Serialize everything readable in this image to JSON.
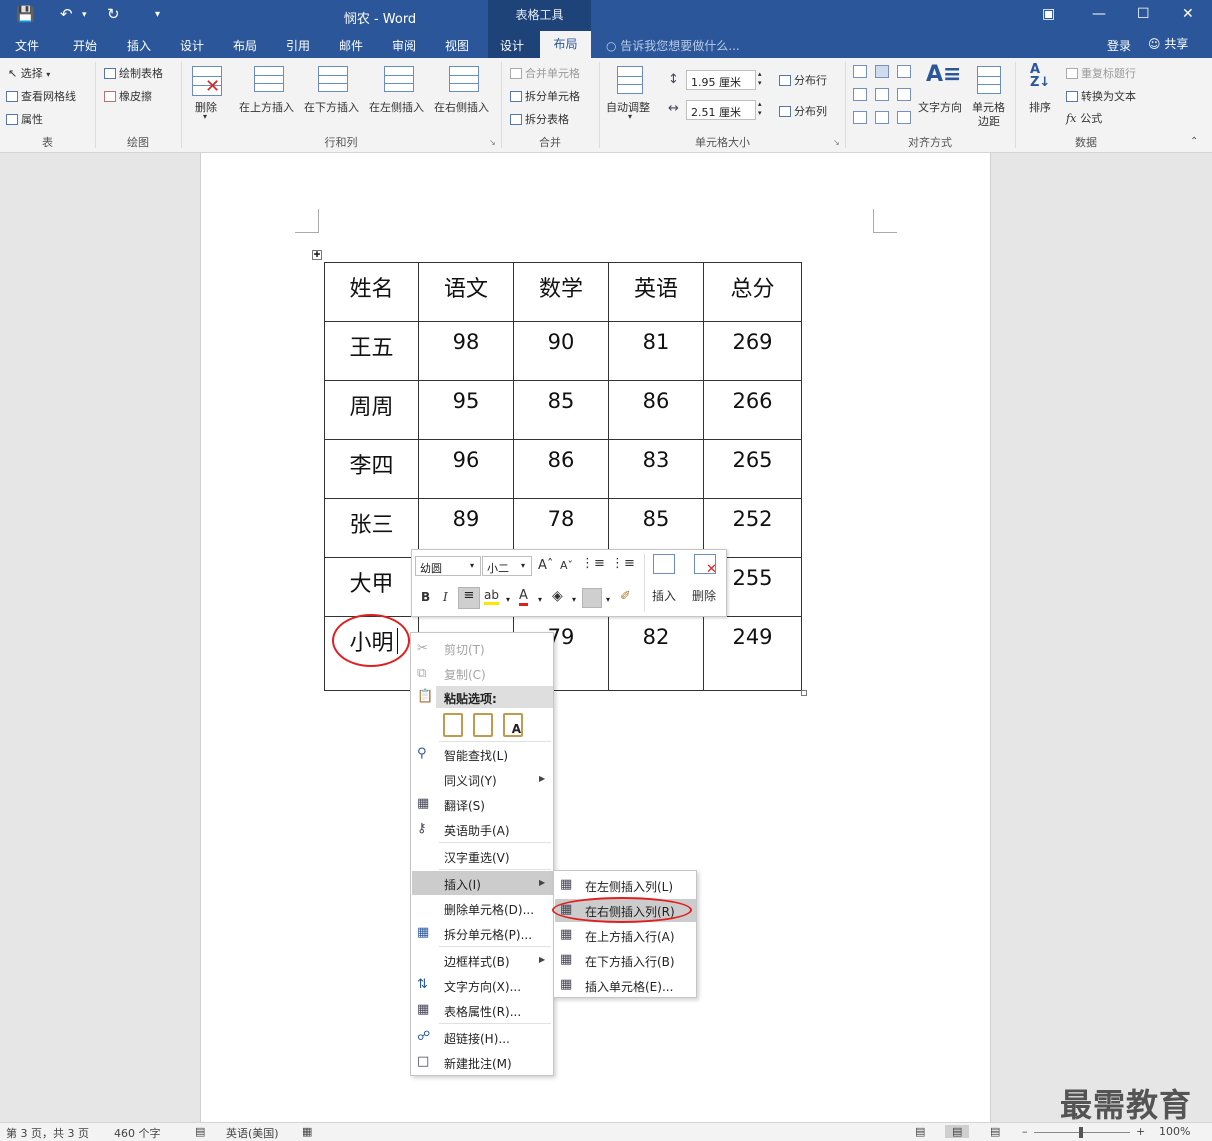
{
  "window": {
    "title": "悯农 - Word",
    "table_tools": "表格工具",
    "login": "登录",
    "share": "共享",
    "tell_me": "告诉我您想要做什么..."
  },
  "tabs": [
    "文件",
    "开始",
    "插入",
    "设计",
    "布局",
    "引用",
    "邮件",
    "审阅",
    "视图",
    "设计",
    "布局"
  ],
  "ribbon": {
    "table_group": {
      "select": "选择",
      "gridlines": "查看网格线",
      "properties": "属性",
      "label": "表"
    },
    "draw_group": {
      "draw_table": "绘制表格",
      "eraser": "橡皮擦",
      "label": "绘图"
    },
    "rows_cols_group": {
      "delete": "删除",
      "insert_above": "在上方插入",
      "insert_below": "在下方插入",
      "insert_left": "在左侧插入",
      "insert_right": "在右侧插入",
      "label": "行和列"
    },
    "merge_group": {
      "merge_cells": "合并单元格",
      "split_cells": "拆分单元格",
      "split_table": "拆分表格",
      "label": "合并"
    },
    "cell_size_group": {
      "autofit": "自动调整",
      "height": "1.95 厘米",
      "width": "2.51 厘米",
      "distribute_rows": "分布行",
      "distribute_cols": "分布列",
      "label": "单元格大小"
    },
    "align_group": {
      "text_direction": "文字方向",
      "cell_margins_l1": "单元格",
      "cell_margins_l2": "边距",
      "label": "对齐方式"
    },
    "data_group": {
      "sort": "排序",
      "repeat_header": "重复标题行",
      "convert_text": "转换为文本",
      "formula": "公式",
      "formula_icon": "fx",
      "label": "数据"
    }
  },
  "table": {
    "headers": [
      "姓名",
      "语文",
      "数学",
      "英语",
      "总分"
    ],
    "rows": [
      [
        "王五",
        "98",
        "90",
        "81",
        "269"
      ],
      [
        "周周",
        "95",
        "85",
        "86",
        "266"
      ],
      [
        "李四",
        "96",
        "86",
        "83",
        "265"
      ],
      [
        "张三",
        "89",
        "78",
        "85",
        "252"
      ],
      [
        "大甲",
        "",
        "",
        "",
        "255"
      ],
      [
        "小明",
        "",
        "79",
        "82",
        "249"
      ]
    ]
  },
  "mini_toolbar": {
    "font": "幼圆",
    "size": "小二",
    "bold": "B",
    "italic": "I",
    "insert": "插入",
    "delete": "删除"
  },
  "context_menu": {
    "cut": "剪切(T)",
    "copy": "复制(C)",
    "paste_options": "粘贴选项:",
    "smart_lookup": "智能查找(L)",
    "synonyms": "同义词(Y)",
    "translate": "翻译(S)",
    "english_assistant": "英语助手(A)",
    "reconvert": "汉字重选(V)",
    "insert": "插入(I)",
    "delete_cells": "删除单元格(D)...",
    "split_cells": "拆分单元格(P)...",
    "border_styles": "边框样式(B)",
    "text_direction": "文字方向(X)...",
    "table_properties": "表格属性(R)...",
    "hyperlink": "超链接(H)...",
    "new_comment": "新建批注(M)"
  },
  "submenu": {
    "insert_left": "在左侧插入列(L)",
    "insert_right": "在右侧插入列(R)",
    "insert_above": "在上方插入行(A)",
    "insert_below": "在下方插入行(B)",
    "insert_cells": "插入单元格(E)..."
  },
  "status": {
    "page": "第 3 页，共 3 页",
    "words": "460 个字",
    "language": "英语(美国)",
    "zoom": "100%"
  },
  "watermark": "最需教育",
  "colors": {
    "brand": "#2b579a",
    "table_tools": "#1e4379",
    "annotation": "#e02020"
  }
}
